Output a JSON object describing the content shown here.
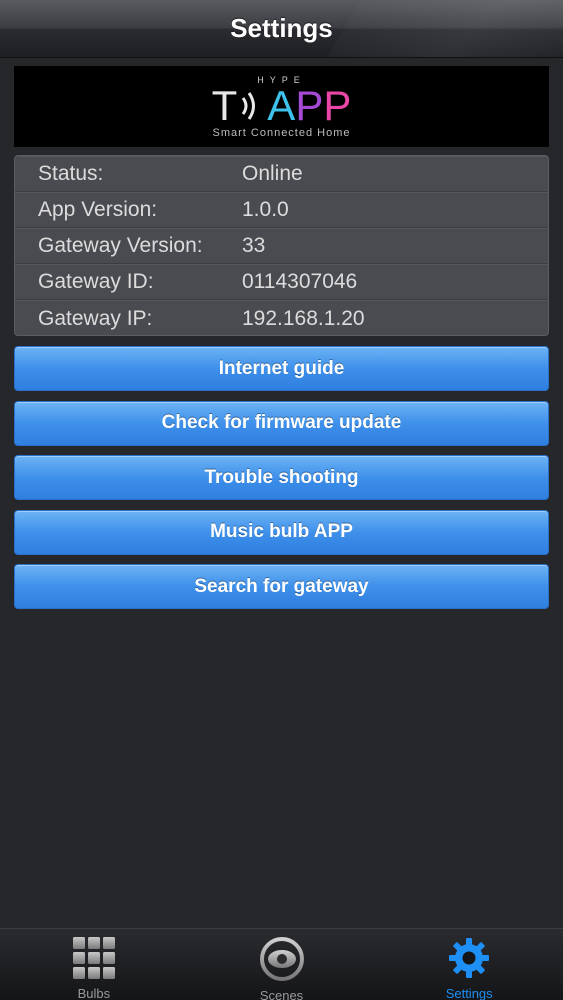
{
  "navbar": {
    "title": "Settings"
  },
  "logo": {
    "top_text": "HYPE",
    "word_t": "T",
    "word_a": "A",
    "word_p1": "P",
    "word_p2": "P",
    "tagline": "Smart Connected Home"
  },
  "info": {
    "rows": [
      {
        "key": "Status:",
        "value": "Online"
      },
      {
        "key": "App Version:",
        "value": "1.0.0"
      },
      {
        "key": "Gateway Version:",
        "value": "33"
      },
      {
        "key": "Gateway ID:",
        "value": "0114307046"
      },
      {
        "key": "Gateway IP:",
        "value": "192.168.1.20"
      }
    ]
  },
  "buttons": [
    {
      "label": "Internet guide"
    },
    {
      "label": "Check for firmware update"
    },
    {
      "label": "Trouble shooting"
    },
    {
      "label": "Music bulb APP"
    },
    {
      "label": "Search for gateway"
    }
  ],
  "tabs": [
    {
      "label": "Bulbs",
      "icon": "grid-icon",
      "active": false
    },
    {
      "label": "Scenes",
      "icon": "eye-icon",
      "active": false
    },
    {
      "label": "Settings",
      "icon": "gear-icon",
      "active": true
    }
  ],
  "colors": {
    "background": "#26272b",
    "button_blue": "#3e90ea",
    "active_tab": "#1e8ff5",
    "inactive_tab": "#9a9a9a"
  }
}
